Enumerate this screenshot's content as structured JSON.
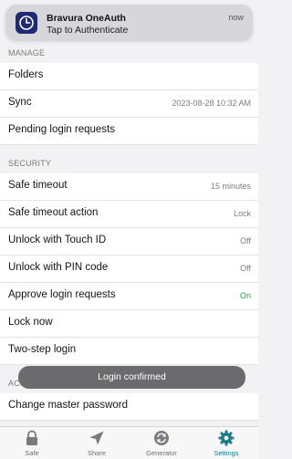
{
  "notification": {
    "app_name": "Bravura OneAuth",
    "message": "Tap to Authenticate",
    "time": "now",
    "icon": "oneauth-clock-icon"
  },
  "sections": {
    "manage": {
      "header": "MANAGE",
      "folders": "Folders",
      "sync": "Sync",
      "sync_value": "2023-08-28 10:32 AM",
      "pending": "Pending login requests"
    },
    "security": {
      "header": "SECURITY",
      "safe_timeout": "Safe timeout",
      "safe_timeout_value": "15 minutes",
      "safe_timeout_action": "Safe timeout action",
      "safe_timeout_action_value": "Lock",
      "touch_id": "Unlock with Touch ID",
      "touch_id_value": "Off",
      "pin_code": "Unlock with PIN code",
      "pin_code_value": "Off",
      "approve": "Approve login requests",
      "approve_value": "On",
      "lock_now": "Lock now",
      "two_step": "Two-step login"
    },
    "account": {
      "header": "ACCOUNT",
      "change_password": "Change master password"
    }
  },
  "toast": "Login confirmed",
  "tabs": [
    {
      "label": "Safe",
      "icon": "lock-icon"
    },
    {
      "label": "Share",
      "icon": "send-icon"
    },
    {
      "label": "Generator",
      "icon": "refresh-icon"
    },
    {
      "label": "Settings",
      "icon": "gear-icon",
      "active": true
    }
  ],
  "colors": {
    "accent": "#1d7a88",
    "on_status": "#2e9a49",
    "app_icon_bg": "#1f2a72"
  }
}
